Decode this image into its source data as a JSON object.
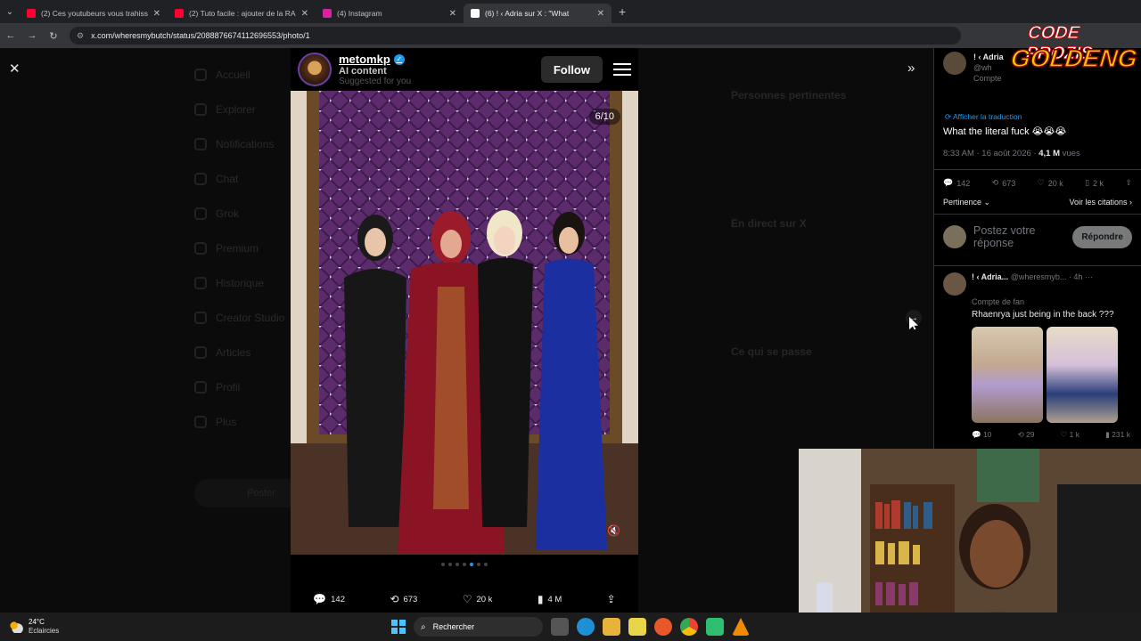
{
  "browser": {
    "tabs": [
      {
        "title": "(2) Ces youtubeurs vous trahiss",
        "favicon_color": "#ff0033"
      },
      {
        "title": "(2) Tuto facile : ajouter de la RA",
        "favicon_color": "#ff0033"
      },
      {
        "title": "(4) Instagram",
        "favicon_color": "#d6249f"
      },
      {
        "title": "(6) ! ‹ Adria sur X : \"What",
        "favicon_color": "#ffffff"
      }
    ],
    "active_tab": 3,
    "url": "x.com/wheresmybutch/status/2088876674112696553/photo/1"
  },
  "viewer": {
    "username": "metomkp",
    "label": "AI content",
    "suggested": "Suggested for you",
    "follow_label": "Follow",
    "counter": "6/10",
    "stats": {
      "replies": "142",
      "reposts": "673",
      "likes": "20 k",
      "views": "4 M"
    }
  },
  "dim_nav": [
    "Accueil",
    "Explorer",
    "Notifications",
    "Chat",
    "Grok",
    "Premium",
    "Historique",
    "Creator Studio",
    "Articles",
    "Profil",
    "Plus"
  ],
  "dim_nav_button": "Poster",
  "dim_side": [
    "Personnes pertinentes",
    "En direct sur X",
    "Ce qui se passe"
  ],
  "tweet": {
    "author": "! ‹ Adria",
    "handle": "@wh",
    "badge": "Compte",
    "translate": "Afficher la traduction",
    "text": "What the literal fuck 😭😭😭",
    "time": "8:33 AM · 16 août 2026 · ",
    "views": "4,1 M",
    "views_label": " vues",
    "stats": {
      "replies": "142",
      "reposts": "673",
      "likes": "20 k",
      "bookmarks": "2 k"
    },
    "sort": "Pertinence",
    "quotes": "Voir les citations"
  },
  "reply_box": {
    "placeholder": "Postez votre réponse",
    "button": "Répondre"
  },
  "reply": {
    "author": "! ‹ Adria...",
    "handle": "@wheresmyb...",
    "time": "· 4h",
    "badge": "Compte de fan",
    "text": "Rhaenrya just being in the back ???",
    "stats": {
      "replies": "10",
      "reposts": "29",
      "likes": "1 k",
      "views": "231 k"
    }
  },
  "overlay_logo": {
    "line1": "CODE PROZIS",
    "line2": "GOLDENG"
  },
  "taskbar": {
    "temp": "24°C",
    "condition": "Eclaircies",
    "search": "Rechercher"
  },
  "colors": {
    "accent": "#1d9bf0",
    "background": "#000000"
  }
}
